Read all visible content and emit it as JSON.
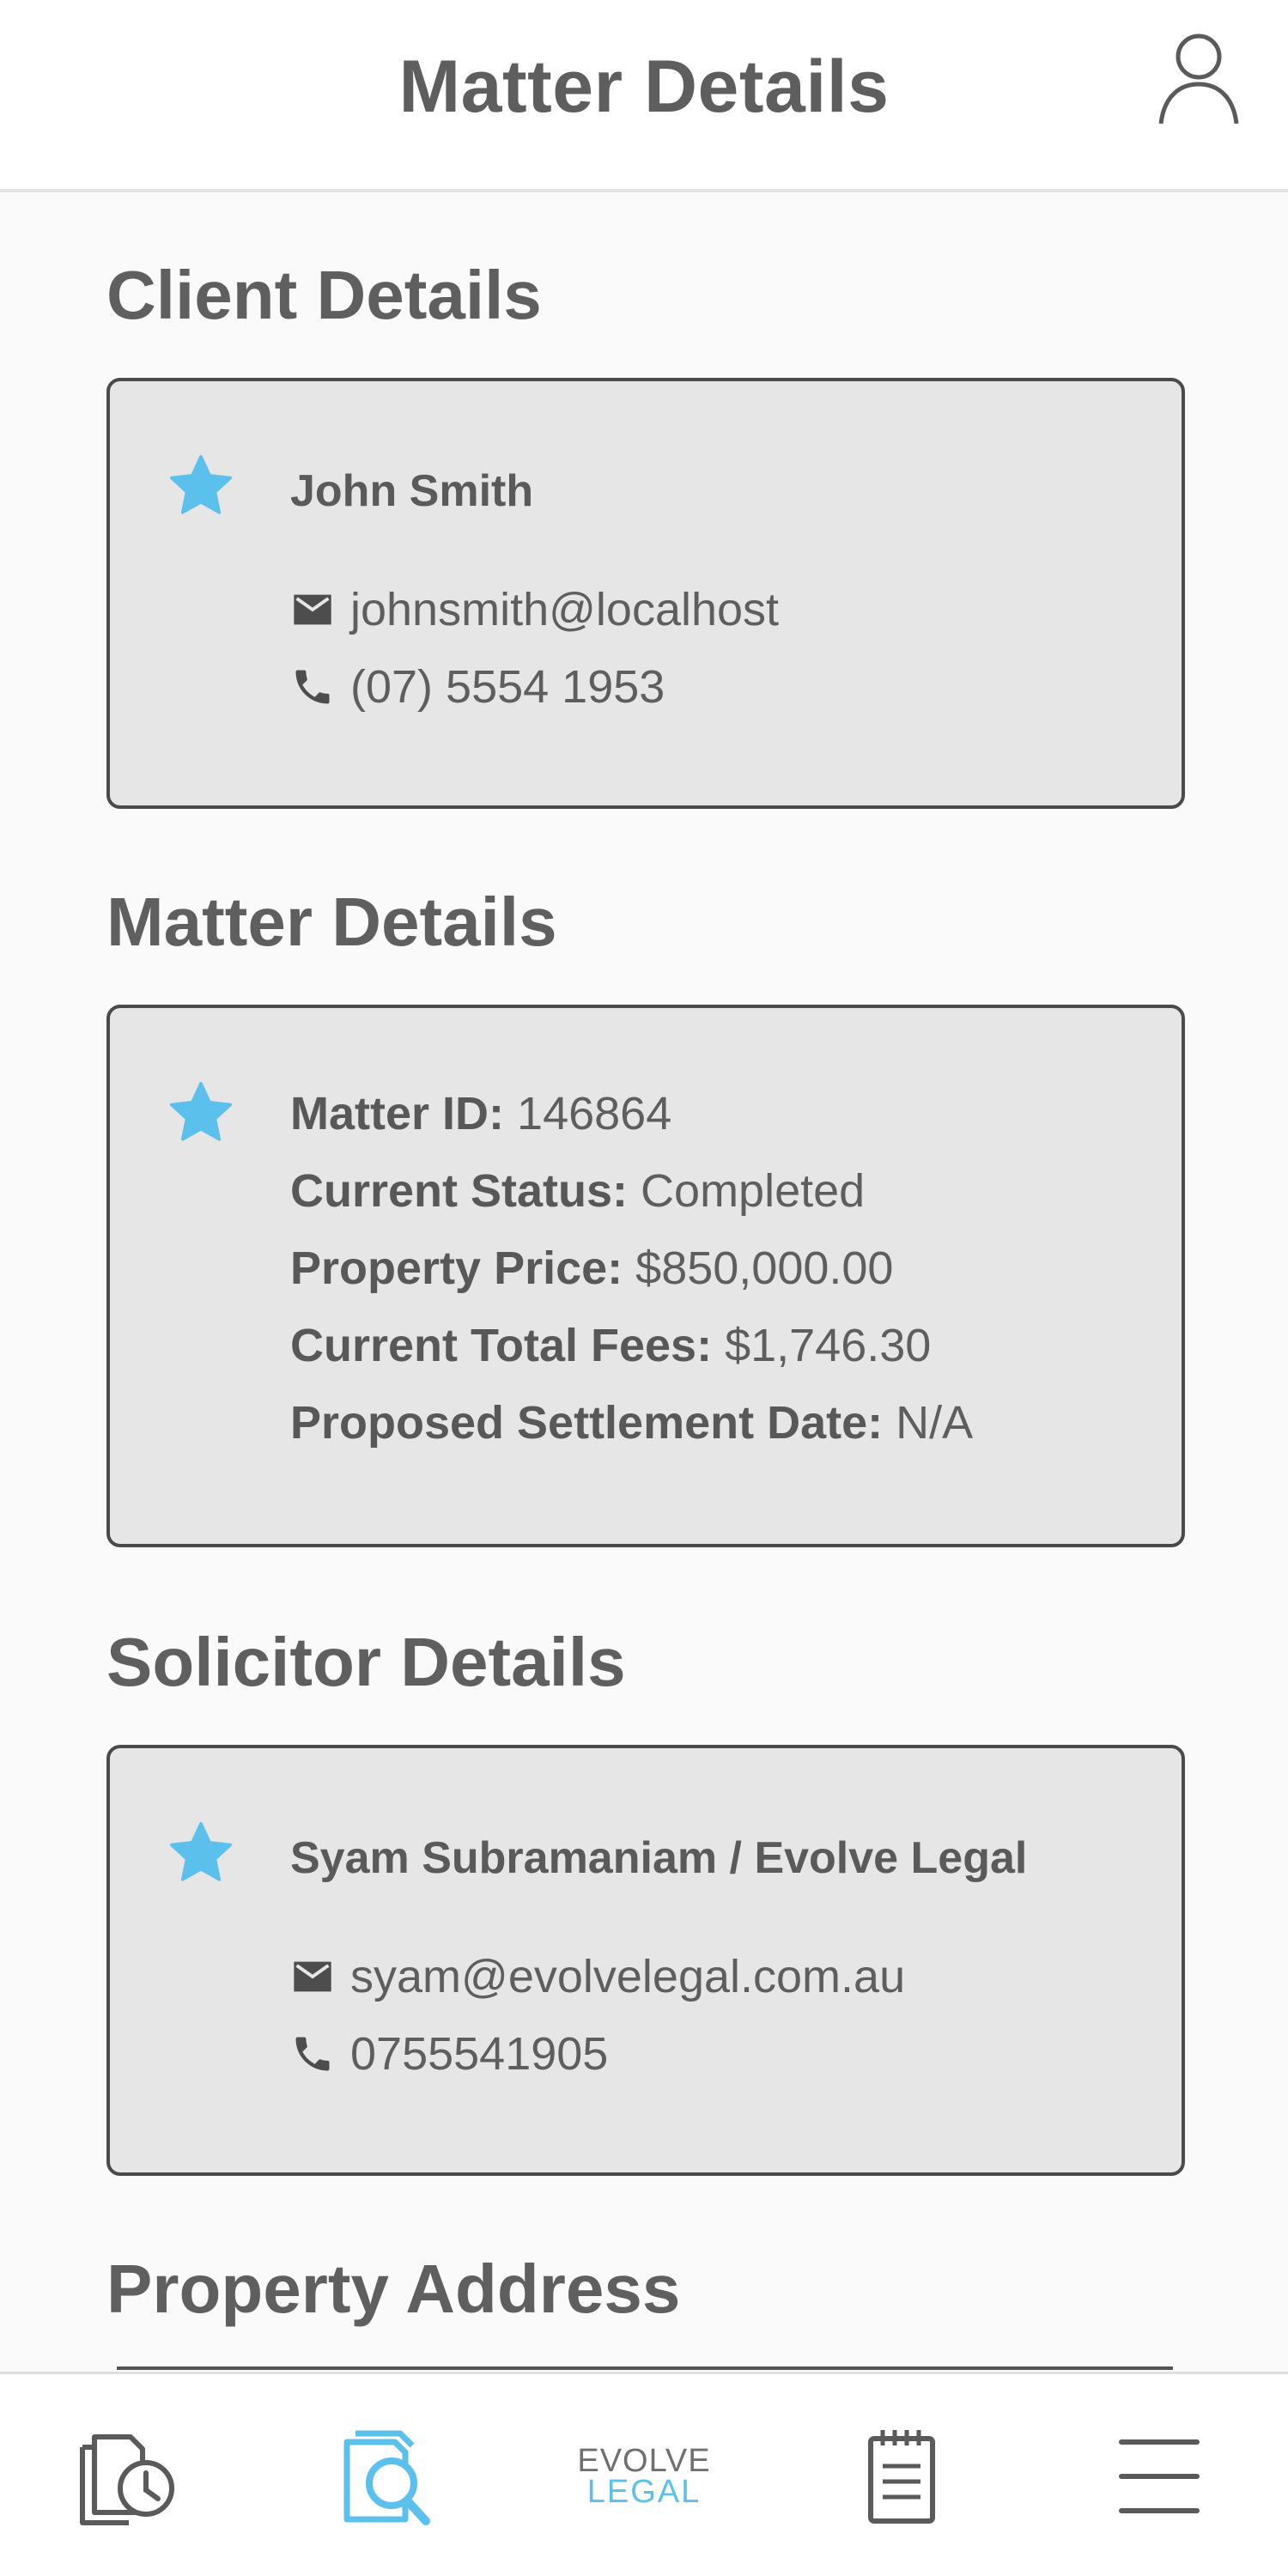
{
  "header": {
    "title": "Matter Details",
    "profile_icon": "user-icon"
  },
  "client": {
    "section_title": "Client Details",
    "name": "John Smith",
    "email": "johnsmith@localhost",
    "phone": "(07) 5554 1953"
  },
  "matter": {
    "section_title": "Matter Details",
    "rows": [
      {
        "label": "Matter ID:",
        "value": "146864"
      },
      {
        "label": "Current Status:",
        "value": "Completed"
      },
      {
        "label": "Property Price:",
        "value": "$850,000.00"
      },
      {
        "label": "Current Total Fees:",
        "value": "$1,746.30"
      },
      {
        "label": "Proposed Settlement Date:",
        "value": "N/A"
      }
    ]
  },
  "solicitor": {
    "section_title": "Solicitor Details",
    "name": "Syam Subramaniam / Evolve Legal",
    "email": "syam@evolvelegal.com.au",
    "phone": "0755541905"
  },
  "property": {
    "section_title": "Property Address"
  },
  "nav": {
    "items": [
      "history-icon",
      "matter-search-icon",
      "evolve-legal-logo",
      "notepad-icon",
      "menu-icon"
    ],
    "logo_top": "EVOLVE",
    "logo_bottom": "LEGAL",
    "active_color": "#5bc0eb",
    "inactive_color": "#5a5a5a"
  },
  "colors": {
    "star": "#5bc0eb",
    "card_bg": "#e6e6e6",
    "card_border": "#4a4a4a"
  }
}
